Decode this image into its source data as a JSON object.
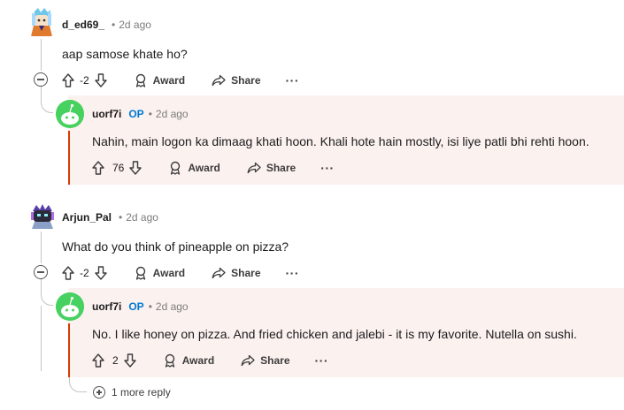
{
  "comments": [
    {
      "username": "d_ed69_",
      "time": "2d ago",
      "text": "aap samose khate ho?",
      "votes": "-2",
      "award_label": "Award",
      "share_label": "Share",
      "more_label": "···",
      "reply": {
        "username": "uorf7i",
        "op_badge": "OP",
        "time": "2d ago",
        "text": "Nahin, main logon ka dimaag khati hoon. Khali hote hain mostly, isi liye patli bhi rehti hoon.",
        "votes": "76",
        "award_label": "Award",
        "share_label": "Share",
        "more_label": "···"
      }
    },
    {
      "username": "Arjun_Pal",
      "time": "2d ago",
      "text": "What do you think of pineapple on pizza?",
      "votes": "-2",
      "award_label": "Award",
      "share_label": "Share",
      "more_label": "···",
      "reply": {
        "username": "uorf7i",
        "op_badge": "OP",
        "time": "2d ago",
        "text": "No. I like honey on pizza. And fried chicken and jalebi - it is my favorite. Nutella on sushi.",
        "votes": "2",
        "award_label": "Award",
        "share_label": "Share",
        "more_label": "···"
      },
      "more_replies_label": "1 more reply"
    }
  ],
  "separator": "•",
  "colors": {
    "op": "#0079d3",
    "reply_bg": "#fbf1ef",
    "reply_bar": "#d93a00"
  }
}
